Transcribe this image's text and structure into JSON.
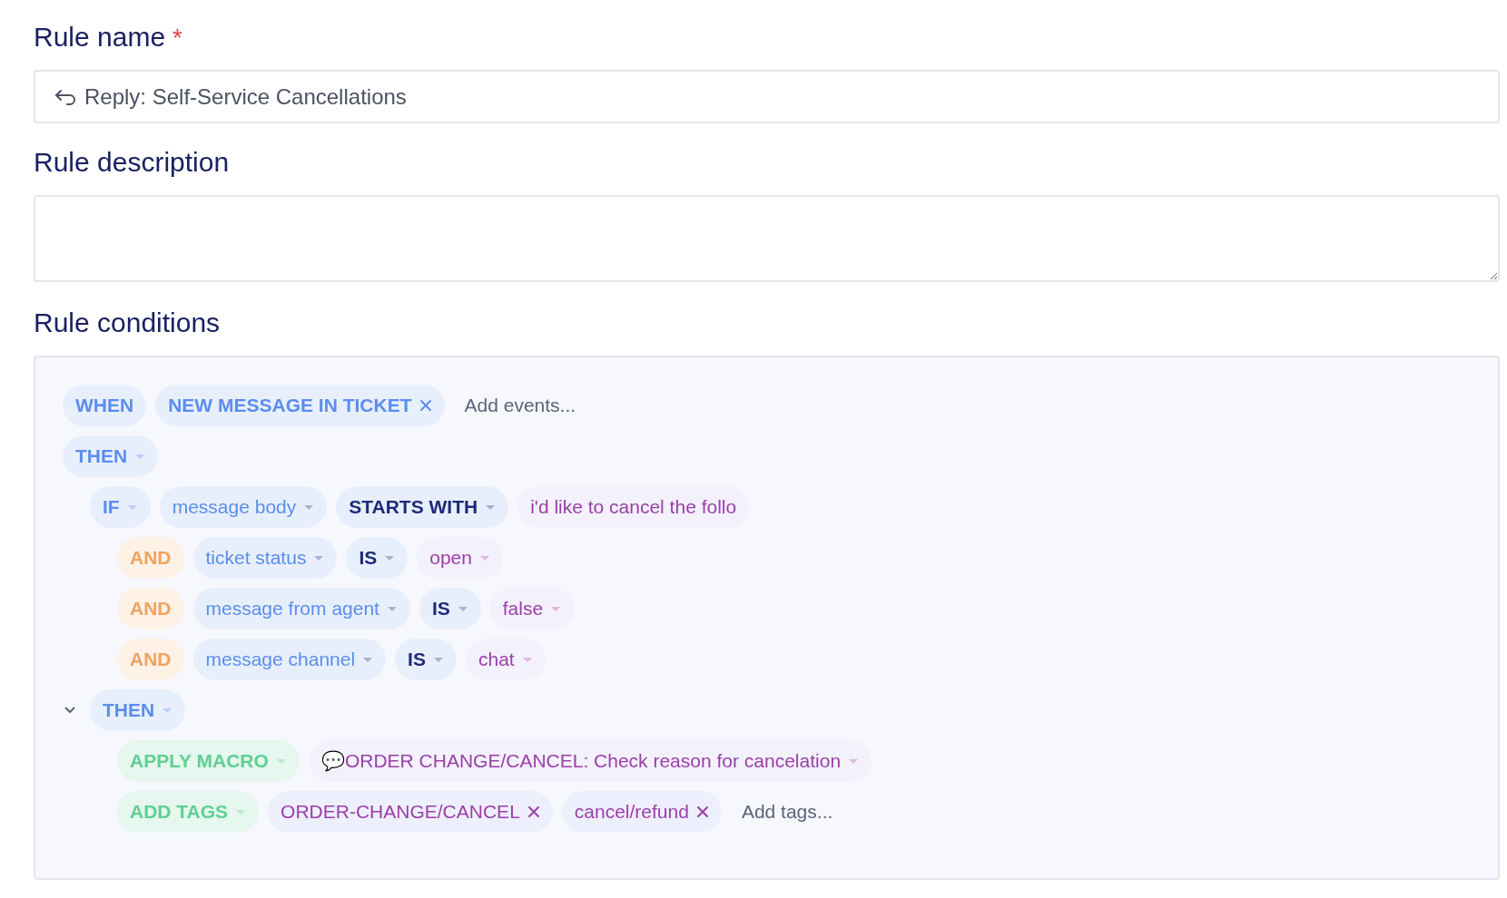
{
  "rule_name": {
    "label": "Rule name",
    "required_mark": "*",
    "value": "Reply: Self-Service Cancellations"
  },
  "rule_description": {
    "label": "Rule description"
  },
  "rule_conditions": {
    "label": "Rule conditions",
    "rows": [
      {
        "tokens": [
          {
            "kind": "keyword",
            "text": "WHEN",
            "dropdown": false
          },
          {
            "kind": "event",
            "text": "NEW MESSAGE IN TICKET",
            "removable": true
          },
          {
            "kind": "add",
            "text": "Add events..."
          }
        ]
      },
      {
        "tokens": [
          {
            "kind": "keyword",
            "text": "THEN",
            "dropdown": true
          }
        ],
        "children": [
          {
            "tokens": [
              {
                "kind": "keyword",
                "text": "IF",
                "dropdown": true
              },
              {
                "kind": "field",
                "text": "message body"
              },
              {
                "kind": "operator",
                "text": "STARTS WITH"
              },
              {
                "kind": "value",
                "text": "i'd like to cancel the follo",
                "dropdown": false
              }
            ],
            "children": [
              {
                "tokens": [
                  {
                    "kind": "connector",
                    "text": "AND"
                  },
                  {
                    "kind": "field",
                    "text": "ticket status"
                  },
                  {
                    "kind": "operator",
                    "text": "IS"
                  },
                  {
                    "kind": "value",
                    "text": "open",
                    "dropdown": true
                  }
                ]
              },
              {
                "tokens": [
                  {
                    "kind": "connector",
                    "text": "AND"
                  },
                  {
                    "kind": "field",
                    "text": "message from agent"
                  },
                  {
                    "kind": "operator",
                    "text": "IS"
                  },
                  {
                    "kind": "value",
                    "text": "false",
                    "dropdown": true
                  }
                ]
              },
              {
                "tokens": [
                  {
                    "kind": "connector",
                    "text": "AND"
                  },
                  {
                    "kind": "field",
                    "text": "message channel"
                  },
                  {
                    "kind": "operator",
                    "text": "IS"
                  },
                  {
                    "kind": "value",
                    "text": "chat",
                    "dropdown": true
                  }
                ]
              }
            ]
          },
          {
            "expanded": true,
            "tokens": [
              {
                "kind": "keyword",
                "text": "THEN",
                "dropdown": true
              }
            ],
            "children": [
              {
                "tokens": [
                  {
                    "kind": "action",
                    "text": "APPLY MACRO"
                  },
                  {
                    "kind": "value",
                    "text": "💬ORDER CHANGE/CANCEL: Check reason for cancelation",
                    "dropdown": true
                  }
                ]
              },
              {
                "tokens": [
                  {
                    "kind": "action",
                    "text": "ADD TAGS"
                  },
                  {
                    "kind": "tag",
                    "text": "ORDER-CHANGE/CANCEL",
                    "removable": true
                  },
                  {
                    "kind": "tag",
                    "text": "cancel/refund",
                    "removable": true
                  },
                  {
                    "kind": "add",
                    "text": "Add tags..."
                  }
                ]
              }
            ]
          }
        ]
      }
    ]
  }
}
